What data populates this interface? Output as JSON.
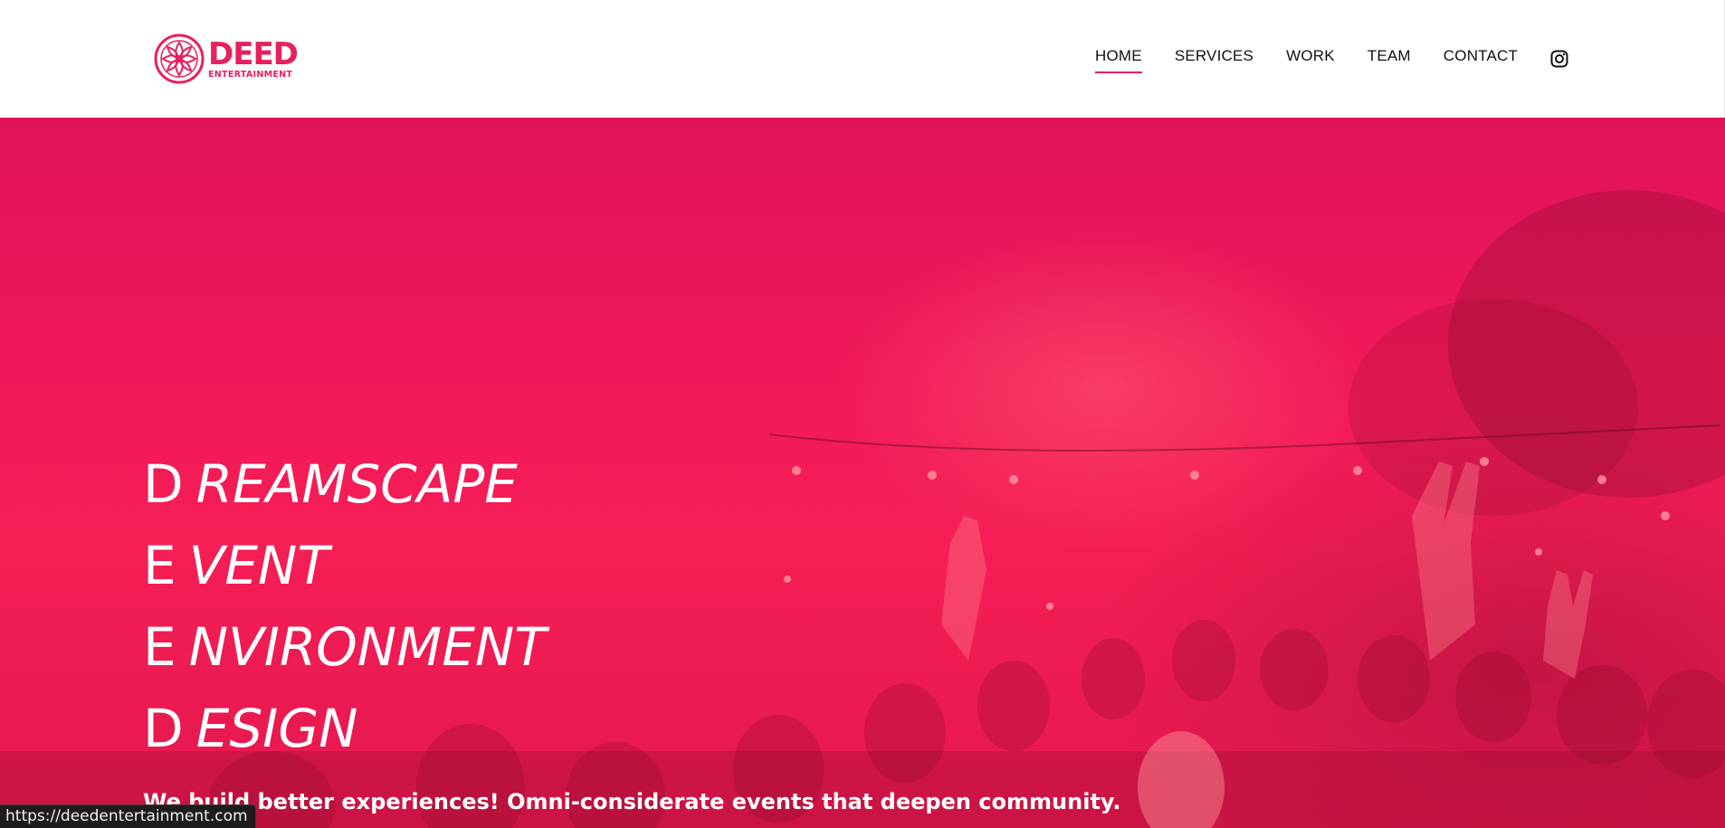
{
  "brand": {
    "name": "DEED",
    "subtitle": "ENTERTAINMENT",
    "color": "#e8205b"
  },
  "nav": {
    "items": [
      {
        "label": "HOME",
        "active": true
      },
      {
        "label": "SERVICES",
        "active": false
      },
      {
        "label": "WORK",
        "active": false
      },
      {
        "label": "TEAM",
        "active": false
      },
      {
        "label": "CONTACT",
        "active": false
      }
    ],
    "social_icon": "instagram-icon"
  },
  "hero": {
    "lines": [
      {
        "cap": "D",
        "rest": "REAMSCAPE"
      },
      {
        "cap": "E",
        "rest": "VENT"
      },
      {
        "cap": "E",
        "rest": "NVIRONMENT"
      },
      {
        "cap": "D",
        "rest": "ESIGN"
      }
    ],
    "tagline": "We build better experiences! Omni-considerate events that deepen community.",
    "overlay_color": "#f0185a"
  },
  "status_bar": {
    "url": "https://deedentertainment.com"
  }
}
